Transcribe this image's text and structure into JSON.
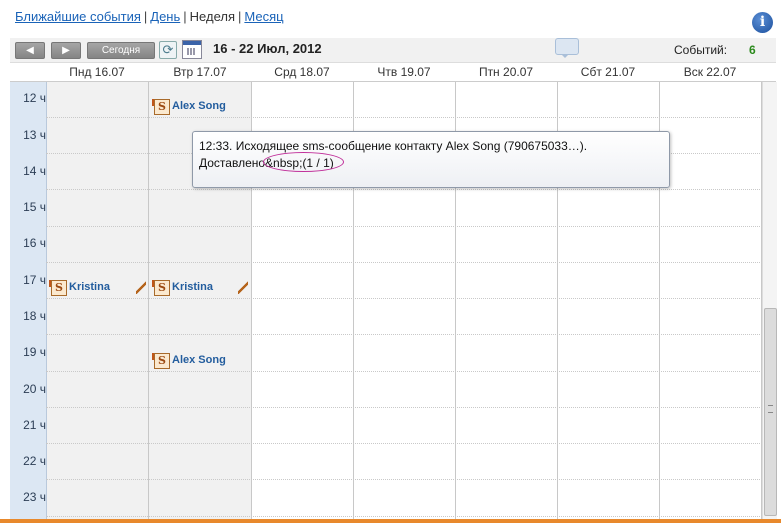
{
  "nav": {
    "upcoming": "Ближайшие события",
    "sep": "|",
    "day": "День",
    "week": "Неделя",
    "month": "Месяц"
  },
  "toolbar": {
    "prev": "◀",
    "next": "▶",
    "today": "Сегодня",
    "date_range": "16 - 22 Июл, 2012",
    "events_label": "Событий:",
    "events_count": "6"
  },
  "days": [
    "Пнд 16.07",
    "Втр 17.07",
    "Срд 18.07",
    "Чтв 19.07",
    "Птн 20.07",
    "Сбт 21.07",
    "Вск 22.07"
  ],
  "hours": [
    "12 ч",
    "13 ч",
    "14 ч",
    "15 ч",
    "16 ч",
    "17 ч",
    "18 ч",
    "19 ч",
    "20 ч",
    "21 ч",
    "22 ч",
    "23 ч"
  ],
  "events": [
    {
      "label": "Alex Song",
      "day": 1,
      "hour": "12 ч"
    },
    {
      "label": "Kristina",
      "day": 0,
      "hour": "17 ч"
    },
    {
      "label": "Kristina",
      "day": 1,
      "hour": "17 ч"
    },
    {
      "label": "Alex Song",
      "day": 1,
      "hour": "19 ч"
    }
  ],
  "tooltip": {
    "line1": "12:33. Исходящее sms-сообщение контакту Alex Song (790675033…).",
    "line2": "Доставлено&nbsp;(1 / 1)"
  },
  "icons": {
    "prev": "arrow-left-icon",
    "next": "arrow-right-icon",
    "refresh": "refresh-icon",
    "calendar": "calendar-icon",
    "message": "message-icon",
    "info": "info-icon",
    "event": "sms-icon",
    "edit": "pencil-icon"
  }
}
